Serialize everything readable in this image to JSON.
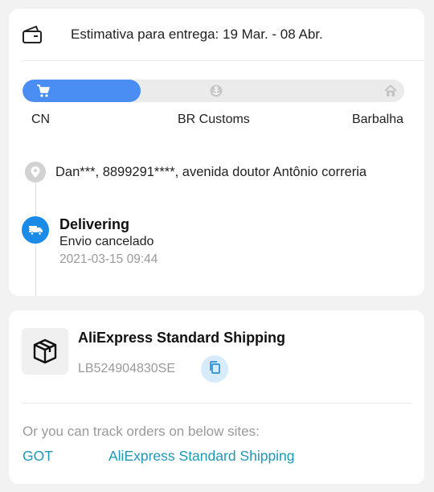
{
  "delivery_estimate": "Estimativa para entrega: 19 Mar. - 08 Abr.",
  "progress": {
    "fraction": 0.31,
    "fill_color": "#4b8ef3",
    "stages": [
      {
        "label": "CN",
        "icon": "shopping-cart-icon"
      },
      {
        "label": "BR Customs",
        "icon": "anchor-icon"
      },
      {
        "label": "Barbalha",
        "icon": "home-icon"
      }
    ]
  },
  "address": "Dan***,  8899291****,  avenida doutor Antônio correria",
  "latest_event": {
    "status": "Delivering",
    "description": "Envio cancelado",
    "timestamp": "2021-03-15 09:44",
    "icon": "truck-icon",
    "icon_color": "#1a8ce8"
  },
  "shipping": {
    "carrier": "AliExpress Standard Shipping",
    "tracking_number": "LB524904830SE",
    "package_icon": "package-icon",
    "copy_icon": "copy-icon"
  },
  "other_sites": {
    "hint": "Or you can track orders on below sites:",
    "links": [
      "GOT",
      "AliExpress Standard Shipping"
    ],
    "link_color": "#1f98b6"
  }
}
